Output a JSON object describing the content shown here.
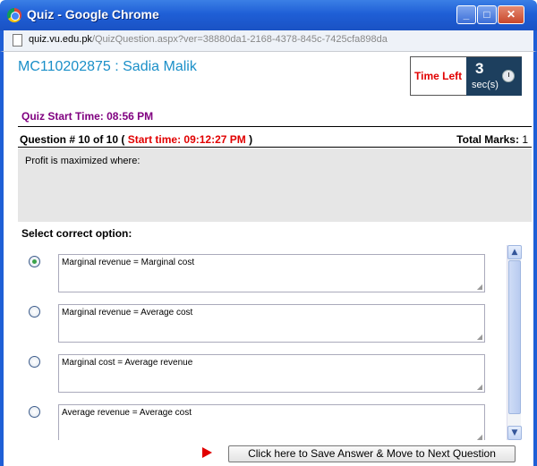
{
  "window": {
    "title": "Quiz - Google Chrome",
    "url_host": "quiz.vu.edu.pk",
    "url_path": "/QuizQuestion.aspx?ver=38880da1-2168-4378-845c-7425cfa898da"
  },
  "student": "MC110202875 : Sadia Malik",
  "timer": {
    "label": "Time Left",
    "value": "3",
    "unit": "sec(s)"
  },
  "quiz_start": "Quiz Start Time: 08:56 PM",
  "question": {
    "number_text": "Question # 10 of 10 (",
    "start_time": "Start time: 09:12:27 PM",
    "close_paren": ")",
    "marks_label": "Total Marks:",
    "marks_value": "1",
    "text": "Profit is maximized where:"
  },
  "select_label": "Select correct option:",
  "options": [
    {
      "text": "Marginal revenue = Marginal cost",
      "checked": true
    },
    {
      "text": "Marginal revenue = Average cost",
      "checked": false
    },
    {
      "text": "Marginal cost = Average revenue",
      "checked": false
    },
    {
      "text": "Average revenue = Average cost",
      "checked": false
    }
  ],
  "save_button": "Click here to Save Answer & Move to Next Question",
  "colors": {
    "accent": "#1a8fc8",
    "alert": "#e10000",
    "purple": "#800080"
  }
}
